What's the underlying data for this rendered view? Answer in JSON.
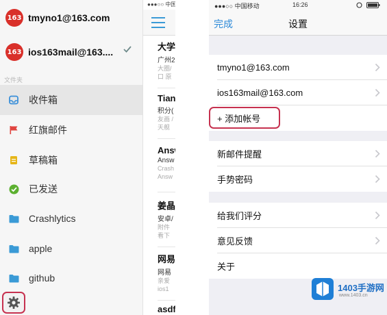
{
  "drawer": {
    "accounts": [
      {
        "logo_text": "163",
        "email": "tmyno1@163.com",
        "selected": false
      },
      {
        "logo_text": "163",
        "email": "ios163mail@163....",
        "selected": true
      }
    ],
    "section_header": "文件夹",
    "folders": [
      {
        "label": "收件箱",
        "icon": "inbox-icon",
        "color": "#3a8fd9",
        "selected": true
      },
      {
        "label": "红旗邮件",
        "icon": "red-flag-icon",
        "color": "#e0443f",
        "selected": false
      },
      {
        "label": "草稿箱",
        "icon": "draft-icon",
        "color": "#e6b619",
        "selected": false
      },
      {
        "label": "已发送",
        "icon": "sent-check-icon",
        "color": "#5cb030",
        "selected": false
      },
      {
        "label": "Crashlytics",
        "icon": "folder-icon",
        "color": "#3a9ad6",
        "selected": false
      },
      {
        "label": "apple",
        "icon": "folder-icon",
        "color": "#3a9ad6",
        "selected": false
      },
      {
        "label": "github",
        "icon": "folder-icon",
        "color": "#3a9ad6",
        "selected": false
      }
    ],
    "settings_icon": "gear-icon"
  },
  "middle": {
    "status_text": "●●●○○ 中国",
    "items": [
      {
        "title": "大学",
        "line1": "广州2",
        "line2": "大圈/",
        "line3": "口 原"
      },
      {
        "title": "Tian",
        "line1": "积分(",
        "line2": "友画 /",
        "line3": "天舰"
      },
      {
        "title": "Answ",
        "line1": "Answ",
        "line2": "Crash",
        "line3": "Answ"
      },
      {
        "title": "姜晶",
        "line1": "安卓/",
        "line2": "附件",
        "line3": "看下"
      },
      {
        "title": "网易",
        "line1": "网易",
        "line2": "亲爱",
        "line3": "ios1"
      },
      {
        "title": "asdf",
        "line1": "",
        "line2": "",
        "line3": ""
      }
    ]
  },
  "settings": {
    "status": {
      "carrier": "●●●○○ 中国移动",
      "time": "16:26"
    },
    "done_label": "完成",
    "title": "设置",
    "accounts": [
      "tmyno1@163.com",
      "ios163mail@163.com"
    ],
    "add_account_label": "+ 添加帐号",
    "group2": [
      "新邮件提醒",
      "手势密码"
    ],
    "group3": [
      "给我们评分",
      "意见反馈",
      "关于"
    ]
  },
  "watermark": {
    "text": "1403手游网",
    "url": "www.1403.cn"
  }
}
